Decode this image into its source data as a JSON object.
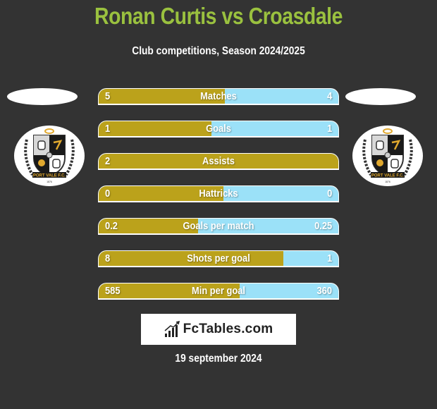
{
  "header": {
    "title": "Ronan Curtis vs Croasdale",
    "subtitle": "Club competitions, Season 2024/2025"
  },
  "teams": {
    "left": {
      "crest": "port-vale-crest",
      "crest_text": "PORT VALE F.C."
    },
    "right": {
      "crest": "port-vale-crest",
      "crest_text": "PORT VALE F.C."
    }
  },
  "colors": {
    "title": "#9AC13F",
    "left_bar": "#BBA21B",
    "right_bar": "#9BE1F8",
    "background": "#333333"
  },
  "stats": [
    {
      "label": "Matches",
      "left": "5",
      "right": "4",
      "left_share": 0.526
    },
    {
      "label": "Goals",
      "left": "1",
      "right": "1",
      "left_share": 0.47
    },
    {
      "label": "Assists",
      "left": "2",
      "right": "",
      "left_share": 1.0
    },
    {
      "label": "Hattricks",
      "left": "0",
      "right": "0",
      "left_share": 0.52
    },
    {
      "label": "Goals per match",
      "left": "0.2",
      "right": "0.25",
      "left_share": 0.415
    },
    {
      "label": "Shots per goal",
      "left": "8",
      "right": "1",
      "left_share": 0.77
    },
    {
      "label": "Min per goal",
      "left": "585",
      "right": "360",
      "left_share": 0.588
    }
  ],
  "brand": {
    "name": "FcTables.com",
    "icon": "bar-chart-icon"
  },
  "date": "19 september 2024"
}
